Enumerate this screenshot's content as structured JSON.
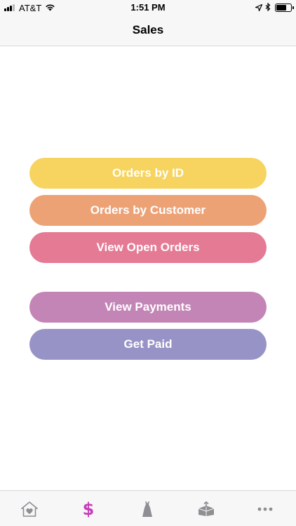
{
  "status_bar": {
    "carrier": "AT&T",
    "time": "1:51 PM",
    "battery_level": 0.7
  },
  "nav": {
    "title": "Sales"
  },
  "buttons": [
    {
      "label": "Orders by ID",
      "color": "#f7d45f"
    },
    {
      "label": "Orders by Customer",
      "color": "#eda276"
    },
    {
      "label": "View Open Orders",
      "color": "#e57a95"
    },
    {
      "label": "View Payments",
      "color": "#c385b6"
    },
    {
      "label": "Get Paid",
      "color": "#9893c6"
    }
  ],
  "tab_bar": {
    "items": [
      {
        "icon": "home-heart-icon",
        "selected": false
      },
      {
        "icon": "dollar-icon",
        "glyph": "$",
        "selected": true
      },
      {
        "icon": "dress-icon",
        "selected": false
      },
      {
        "icon": "box-icon",
        "selected": false
      },
      {
        "icon": "more-icon",
        "selected": false
      }
    ],
    "active_color": "#c53fb9",
    "inactive_color": "#8e8e93"
  }
}
